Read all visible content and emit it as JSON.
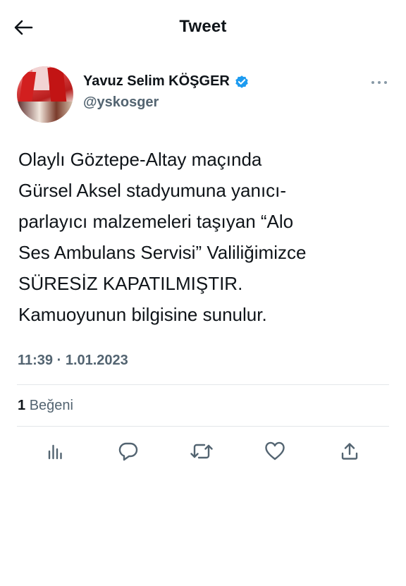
{
  "header": {
    "title": "Tweet",
    "back_icon": "arrow-left-icon"
  },
  "author": {
    "display_name": "Yavuz Selim KÖŞGER",
    "handle": "@yskosger",
    "verified": true,
    "verified_color": "#1d9bf0",
    "more_icon": "more-dots-icon"
  },
  "tweet": {
    "text": "Olaylı Göztepe-Altay maçında\nGürsel Aksel stadyumuna yanıcı-\nparlayıcı malzemeleri taşıyan “Alo\nSes Ambulans Servisi” Valiliğimizce\nSÜRESİZ KAPATILMIŞTIR.\nKamuoyunun bilgisine sunulur.",
    "timestamp": "11:39 · 1.01.2023"
  },
  "stats": {
    "likes_count": "1",
    "likes_label": "Beğeni"
  },
  "actions": [
    {
      "name": "analytics",
      "icon": "analytics-icon"
    },
    {
      "name": "reply",
      "icon": "reply-icon"
    },
    {
      "name": "retweet",
      "icon": "retweet-icon"
    },
    {
      "name": "like",
      "icon": "heart-icon"
    },
    {
      "name": "share",
      "icon": "share-icon"
    }
  ],
  "colors": {
    "text": "#0f1419",
    "secondary": "#536471",
    "accent": "#1d9bf0",
    "divider": "#e3e6e9"
  }
}
